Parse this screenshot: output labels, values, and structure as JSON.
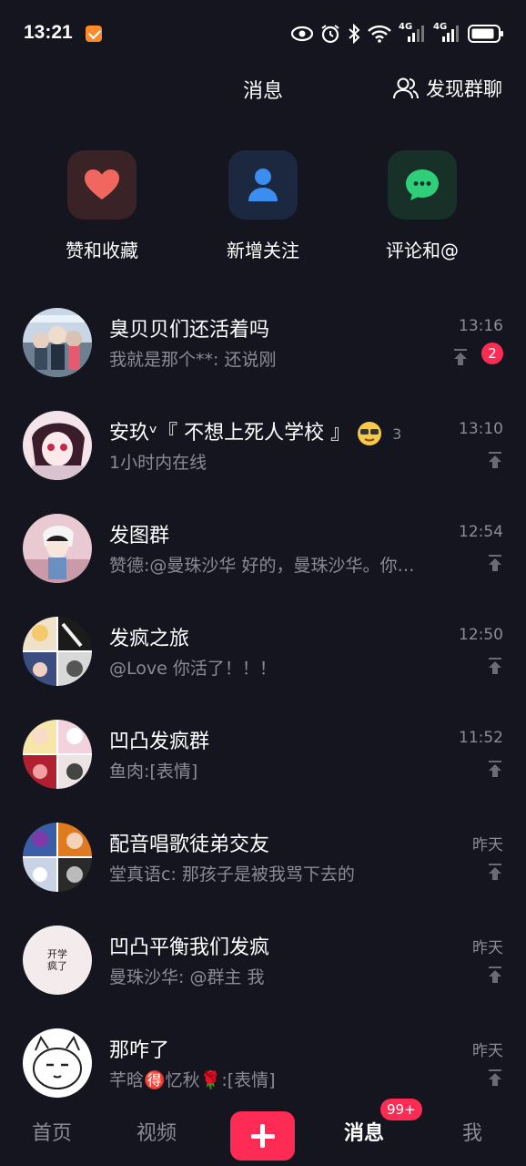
{
  "status": {
    "time": "13:21",
    "network1": "4G",
    "network2": "4G"
  },
  "header": {
    "title": "消息",
    "discover_label": "发现群聊"
  },
  "quick_actions": [
    {
      "label": "赞和收藏",
      "icon": "heart-icon",
      "bg": "#3a2326",
      "color": "#f0675f"
    },
    {
      "label": "新增关注",
      "icon": "person-icon",
      "bg": "#1c2840",
      "color": "#3b8df0"
    },
    {
      "label": "评论和@",
      "icon": "chat-bubble-icon",
      "bg": "#173028",
      "color": "#2fcf7a"
    }
  ],
  "conversations": [
    {
      "title": "臭贝贝们还活着吗",
      "preview": "我就是那个**: 还说刚",
      "time": "13:16",
      "unread": "2",
      "pinned": true
    },
    {
      "title": "安玖ᵛ『 不想上死人学校 』",
      "title_suffix": "3",
      "preview": "1小时内在线",
      "time": "13:10",
      "pinned": true
    },
    {
      "title": "发图群",
      "preview": "赞德:@曼珠沙华 好的，曼珠沙华。你…",
      "time": "12:54",
      "pinned": true
    },
    {
      "title": "发疯之旅",
      "preview": "@Love 你活了！！！",
      "time": "12:50",
      "pinned": true
    },
    {
      "title": "凹凸发疯群",
      "preview": "鱼肉:[表情]",
      "time": "11:52",
      "pinned": true
    },
    {
      "title": "配音唱歌徒弟交友",
      "preview": "堂真语c: 那孩子是被我骂下去的",
      "time": "昨天",
      "pinned": true
    },
    {
      "title": "凹凸平衡我们发疯",
      "preview": "曼珠沙华: @群主 我",
      "time": "昨天",
      "pinned": true,
      "avatar_text": "开学疯了"
    },
    {
      "title": "那咋了",
      "preview": "芊晗🉐忆秋🌹:[表情]",
      "time": "昨天",
      "pinned": true
    }
  ],
  "tabbar": {
    "home": "首页",
    "video": "视频",
    "messages": "消息",
    "messages_badge": "99+",
    "me": "我"
  }
}
